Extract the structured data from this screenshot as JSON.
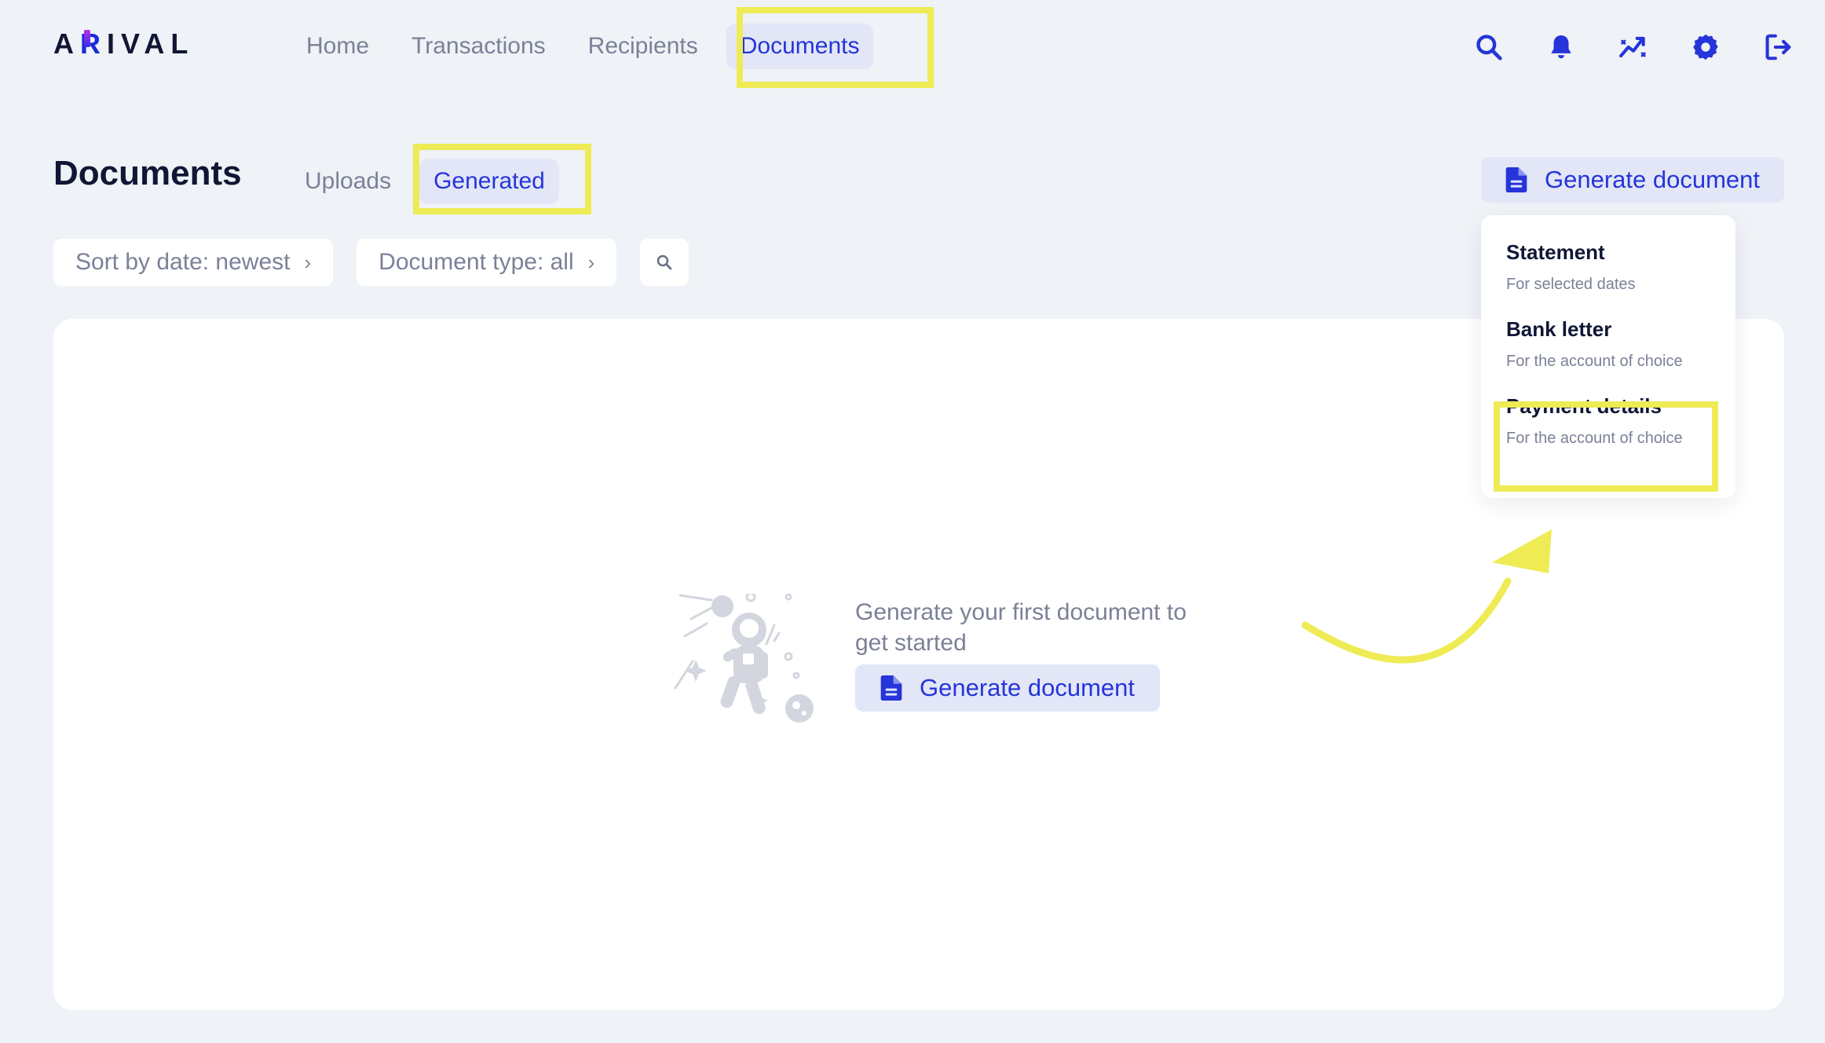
{
  "header": {
    "logo": "ARIVAL",
    "logo_pre": "A",
    "logo_r": "R",
    "logo_post": "IVAL",
    "nav": [
      {
        "label": "Home"
      },
      {
        "label": "Transactions"
      },
      {
        "label": "Recipients"
      },
      {
        "label": "Documents",
        "active": true
      }
    ],
    "icons": [
      "search-icon",
      "bell-icon",
      "analytics-icon",
      "gear-icon",
      "logout-icon"
    ]
  },
  "page": {
    "title": "Documents",
    "tabs": [
      {
        "label": "Uploads"
      },
      {
        "label": "Generated",
        "active": true
      }
    ],
    "generate_button": "Generate document"
  },
  "filters": {
    "sort": "Sort by date: newest",
    "type": "Document type: all"
  },
  "empty_state": {
    "message": "Generate your first document to get started",
    "button": "Generate document"
  },
  "dropdown": {
    "items": [
      {
        "title": "Statement",
        "subtitle": "For selected dates"
      },
      {
        "title": "Bank letter",
        "subtitle": "For the account of choice"
      },
      {
        "title": "Payment details",
        "subtitle": "For the account of choice"
      }
    ]
  },
  "colors": {
    "accent": "#2535d9",
    "background": "#eff2f6",
    "highlight": "#eeeb55",
    "muted_text": "#7b8197"
  }
}
